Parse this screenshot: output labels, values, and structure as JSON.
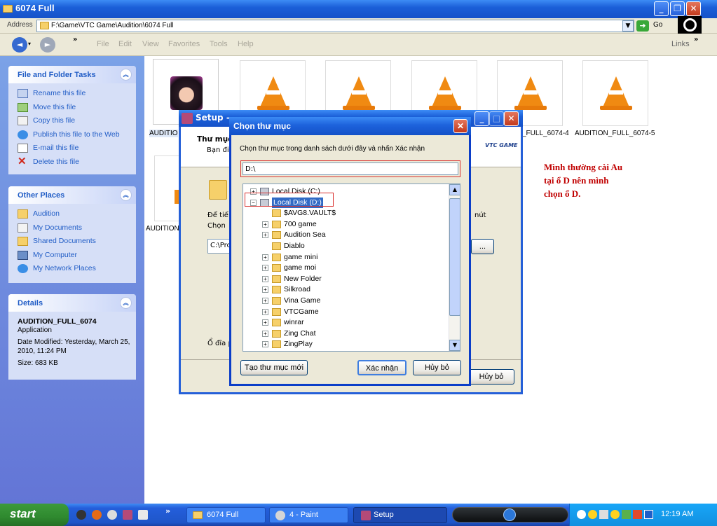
{
  "window": {
    "title": "6074 Full"
  },
  "address": {
    "label": "Address",
    "value": "F:\\Game\\VTC Game\\Audition\\6074 Full",
    "go": "Go"
  },
  "menu": [
    "File",
    "Edit",
    "View",
    "Favorites",
    "Tools",
    "Help"
  ],
  "links": "Links",
  "panels": {
    "tasks": {
      "title": "File and Folder Tasks",
      "items": [
        "Rename this file",
        "Move this file",
        "Copy this file",
        "Publish this file to the Web",
        "E-mail this file",
        "Delete this file"
      ]
    },
    "places": {
      "title": "Other Places",
      "items": [
        "Audition",
        "My Documents",
        "Shared Documents",
        "My Computer",
        "My Network Places"
      ]
    },
    "details": {
      "title": "Details",
      "name": "AUDITION_FULL_6074",
      "type": "Application",
      "modified": "Date Modified: Yesterday, March 25, 2010, 11:24 PM",
      "size": "Size: 683 KB"
    }
  },
  "files": {
    "row1": [
      "AUDITIO",
      "",
      "",
      "",
      "_FULL_6074-4",
      "AUDITION_FULL_6074-5"
    ],
    "row2": [
      "AUDITION"
    ]
  },
  "setup": {
    "title": "Setup - ",
    "heading": "Thư mục",
    "sub": "Bạn đi",
    "text1": "Để tiế",
    "text2": "Chọn",
    "path": "C:\\Pro",
    "browse": "...",
    "right_text": "nút",
    "bottom": "Ổ đĩa p",
    "cancel": "Hủy bỏ",
    "logo": "VTC GAME"
  },
  "dialog": {
    "title": "Chọn thư mục",
    "instruction": "Chọn thư mục trong danh sách dưới đây và nhấn Xác nhận",
    "path": "D:\\",
    "new_folder": "Tạo thư mục mới",
    "ok": "Xác nhận",
    "cancel": "Hủy bỏ"
  },
  "tree": [
    {
      "label": "Local Disk (C:)",
      "expander": "+"
    },
    {
      "label": "Local Disk (D:)",
      "expander": "−"
    },
    {
      "label": "$AVG8.VAULT$",
      "expander": ""
    },
    {
      "label": "700 game",
      "expander": "+"
    },
    {
      "label": "Audition Sea",
      "expander": "+"
    },
    {
      "label": "Diablo",
      "expander": ""
    },
    {
      "label": "game mini",
      "expander": "+"
    },
    {
      "label": "game moi",
      "expander": "+"
    },
    {
      "label": "New Folder",
      "expander": "+"
    },
    {
      "label": "Silkroad",
      "expander": "+"
    },
    {
      "label": "Vina Game",
      "expander": "+"
    },
    {
      "label": "VTCGame",
      "expander": "+"
    },
    {
      "label": "winrar",
      "expander": "+"
    },
    {
      "label": "Zing Chat",
      "expander": "+"
    },
    {
      "label": "ZingPlay",
      "expander": "+"
    }
  ],
  "annotation": {
    "line1": "Mình thường cài Au",
    "line2": "tại ổ D nên mình",
    "line3": "chọn ổ D."
  },
  "taskbar": {
    "start": "start",
    "tasks": [
      "6074 Full",
      "4 - Paint",
      "Setup"
    ],
    "clock": "12:19 AM"
  },
  "colors": {
    "xp_blue": "#245edb",
    "accent_red": "#c00000",
    "link_blue": "#215dc6"
  }
}
